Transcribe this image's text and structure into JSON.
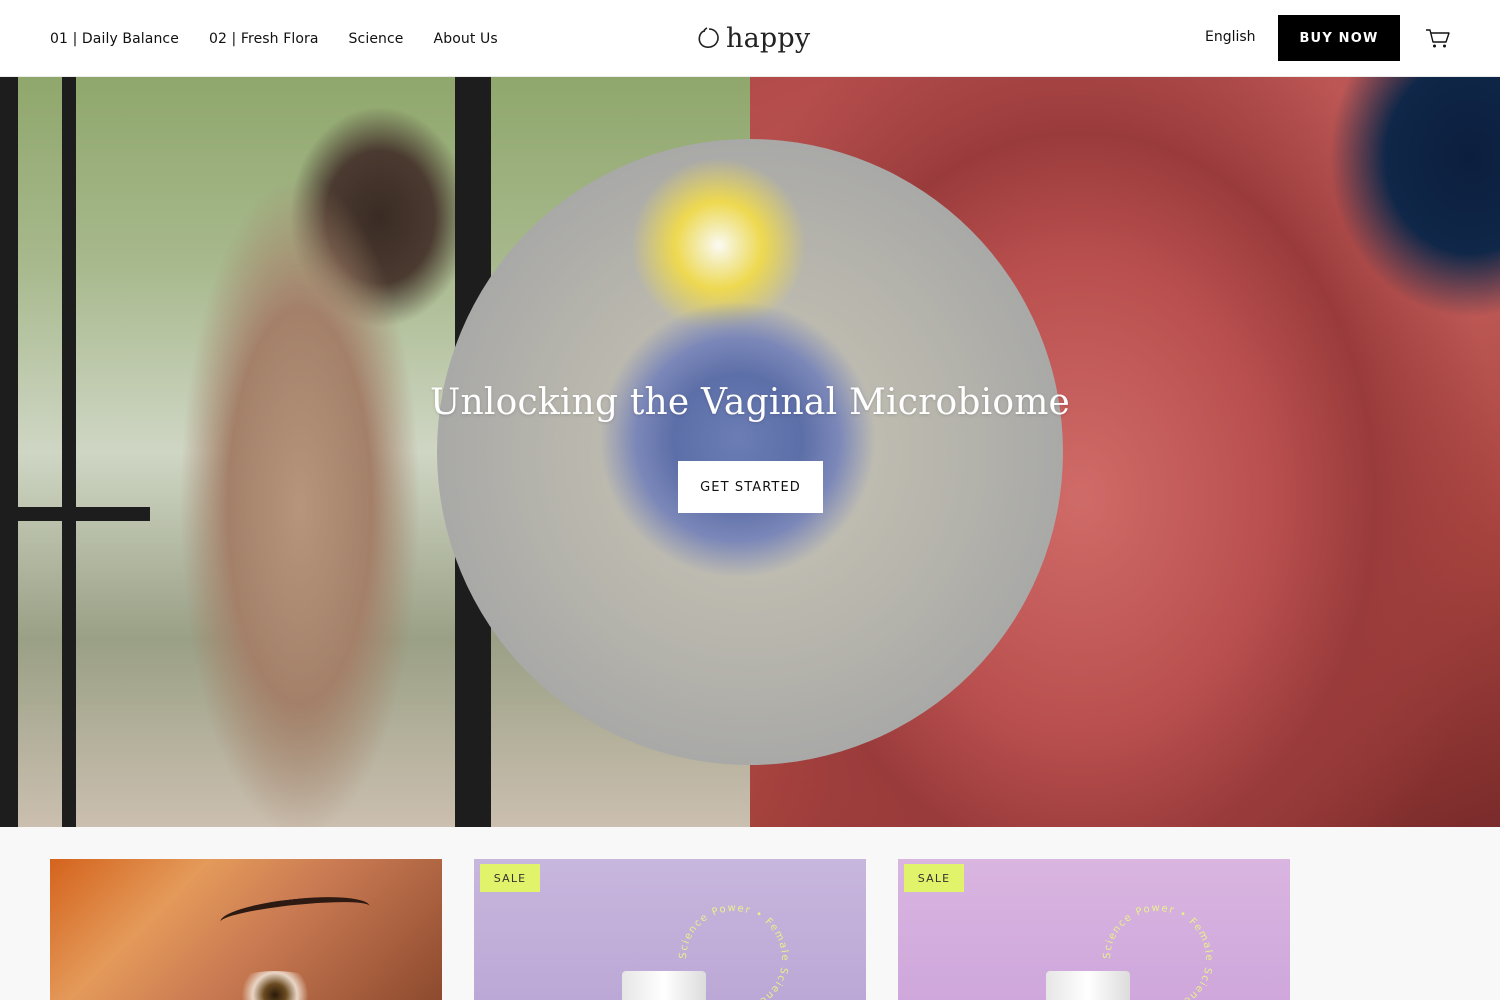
{
  "header": {
    "nav": [
      {
        "label": "01 | Daily Balance"
      },
      {
        "label": "02 | Fresh Flora"
      },
      {
        "label": "Science"
      },
      {
        "label": "About Us"
      }
    ],
    "logo_text": "happy",
    "language": "English",
    "buy_now": "BUY NOW",
    "cart_icon": "cart-icon"
  },
  "hero": {
    "title": "Unlocking the Vaginal Microbiome",
    "cta": "GET STARTED"
  },
  "products": [
    {
      "badge": ""
    },
    {
      "badge": "SALE",
      "circle_text": "Science Power • Female Science Power •"
    },
    {
      "badge": "SALE",
      "circle_text": "Science Power • Female Science Power •"
    }
  ],
  "colors": {
    "accent": "#000000",
    "sale_badge": "#e1f36a",
    "card_lavender": "#c1addb",
    "card_pink": "#d4aede"
  }
}
